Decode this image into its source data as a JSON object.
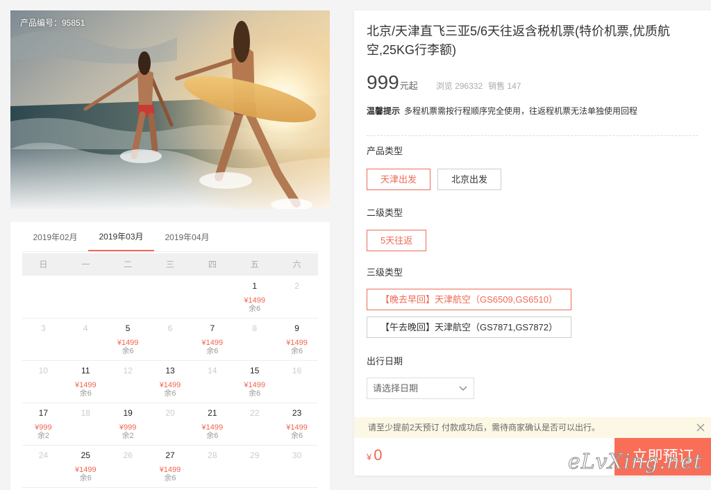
{
  "colors": {
    "accent": "#ef6a55",
    "price": "#f0654f",
    "button": "#fa6e58",
    "page_bg": "#f4f4f4",
    "notice_bg": "#fdf8e5"
  },
  "photo": {
    "product_id_label": "产品编号：95851"
  },
  "calendar": {
    "months": [
      {
        "label": "2019年02月",
        "active": false
      },
      {
        "label": "2019年03月",
        "active": true
      },
      {
        "label": "2019年04月",
        "active": false
      }
    ],
    "weekdays": [
      "日",
      "一",
      "二",
      "三",
      "四",
      "五",
      "六"
    ],
    "weeks": [
      [
        null,
        null,
        null,
        null,
        null,
        {
          "day": "1",
          "price": "¥1499",
          "stock": "余6"
        },
        {
          "day": "2"
        }
      ],
      [
        {
          "day": "3"
        },
        {
          "day": "4"
        },
        {
          "day": "5",
          "price": "¥1499",
          "stock": "余6"
        },
        {
          "day": "6"
        },
        {
          "day": "7",
          "price": "¥1499",
          "stock": "余6"
        },
        {
          "day": "8"
        },
        {
          "day": "9",
          "price": "¥1499",
          "stock": "余6"
        }
      ],
      [
        {
          "day": "10"
        },
        {
          "day": "11",
          "price": "¥1499",
          "stock": "余6"
        },
        {
          "day": "12"
        },
        {
          "day": "13",
          "price": "¥1499",
          "stock": "余6"
        },
        {
          "day": "14"
        },
        {
          "day": "15",
          "price": "¥1499",
          "stock": "余6"
        },
        {
          "day": "16"
        }
      ],
      [
        {
          "day": "17",
          "price": "¥999",
          "stock": "余2"
        },
        {
          "day": "18"
        },
        {
          "day": "19",
          "price": "¥999",
          "stock": "余2"
        },
        {
          "day": "20"
        },
        {
          "day": "21",
          "price": "¥1499",
          "stock": "余6"
        },
        {
          "day": "22"
        },
        {
          "day": "23",
          "price": "¥1499",
          "stock": "余6"
        }
      ],
      [
        {
          "day": "24"
        },
        {
          "day": "25",
          "price": "¥1499",
          "stock": "余6"
        },
        {
          "day": "26"
        },
        {
          "day": "27",
          "price": "¥1499",
          "stock": "余6"
        },
        {
          "day": "28"
        },
        {
          "day": "29"
        },
        {
          "day": "30"
        }
      ]
    ]
  },
  "product": {
    "title": "北京/天津直飞三亚5/6天往返含税机票(特价机票,优质航空,25KG行李额)",
    "price": "999",
    "price_unit": "元起",
    "views": "浏览 296332",
    "sales": "销售 147",
    "tip_label": "温馨提示",
    "tip_text": "多程机票需按行程顺序完全使用，往返程机票无法单独使用回程",
    "product_type": {
      "label": "产品类型",
      "items": [
        {
          "label": "天津出发",
          "selected": true
        },
        {
          "label": "北京出发",
          "selected": false
        }
      ]
    },
    "sub_type": {
      "label": "二级类型",
      "items": [
        {
          "label": "5天往返",
          "selected": true
        }
      ]
    },
    "third_type": {
      "label": "三级类型",
      "items": [
        {
          "label": "【晚去早回】天津航空（GS6509,GS6510）",
          "selected": true
        },
        {
          "label": "【午去晚回】天津航空（GS7871,GS7872）",
          "selected": false
        }
      ]
    },
    "travel_date": {
      "label": "出行日期",
      "placeholder": "请选择日期",
      "icon": "chevron-down-icon"
    },
    "notice": {
      "text": "请至少提前2天预订 付款成功后，需待商家确认是否可以出行。",
      "icon": "close-icon"
    },
    "total": {
      "currency": "¥",
      "amount": "0"
    },
    "book_button": "立即预订"
  },
  "watermark": "eLvXing.net"
}
